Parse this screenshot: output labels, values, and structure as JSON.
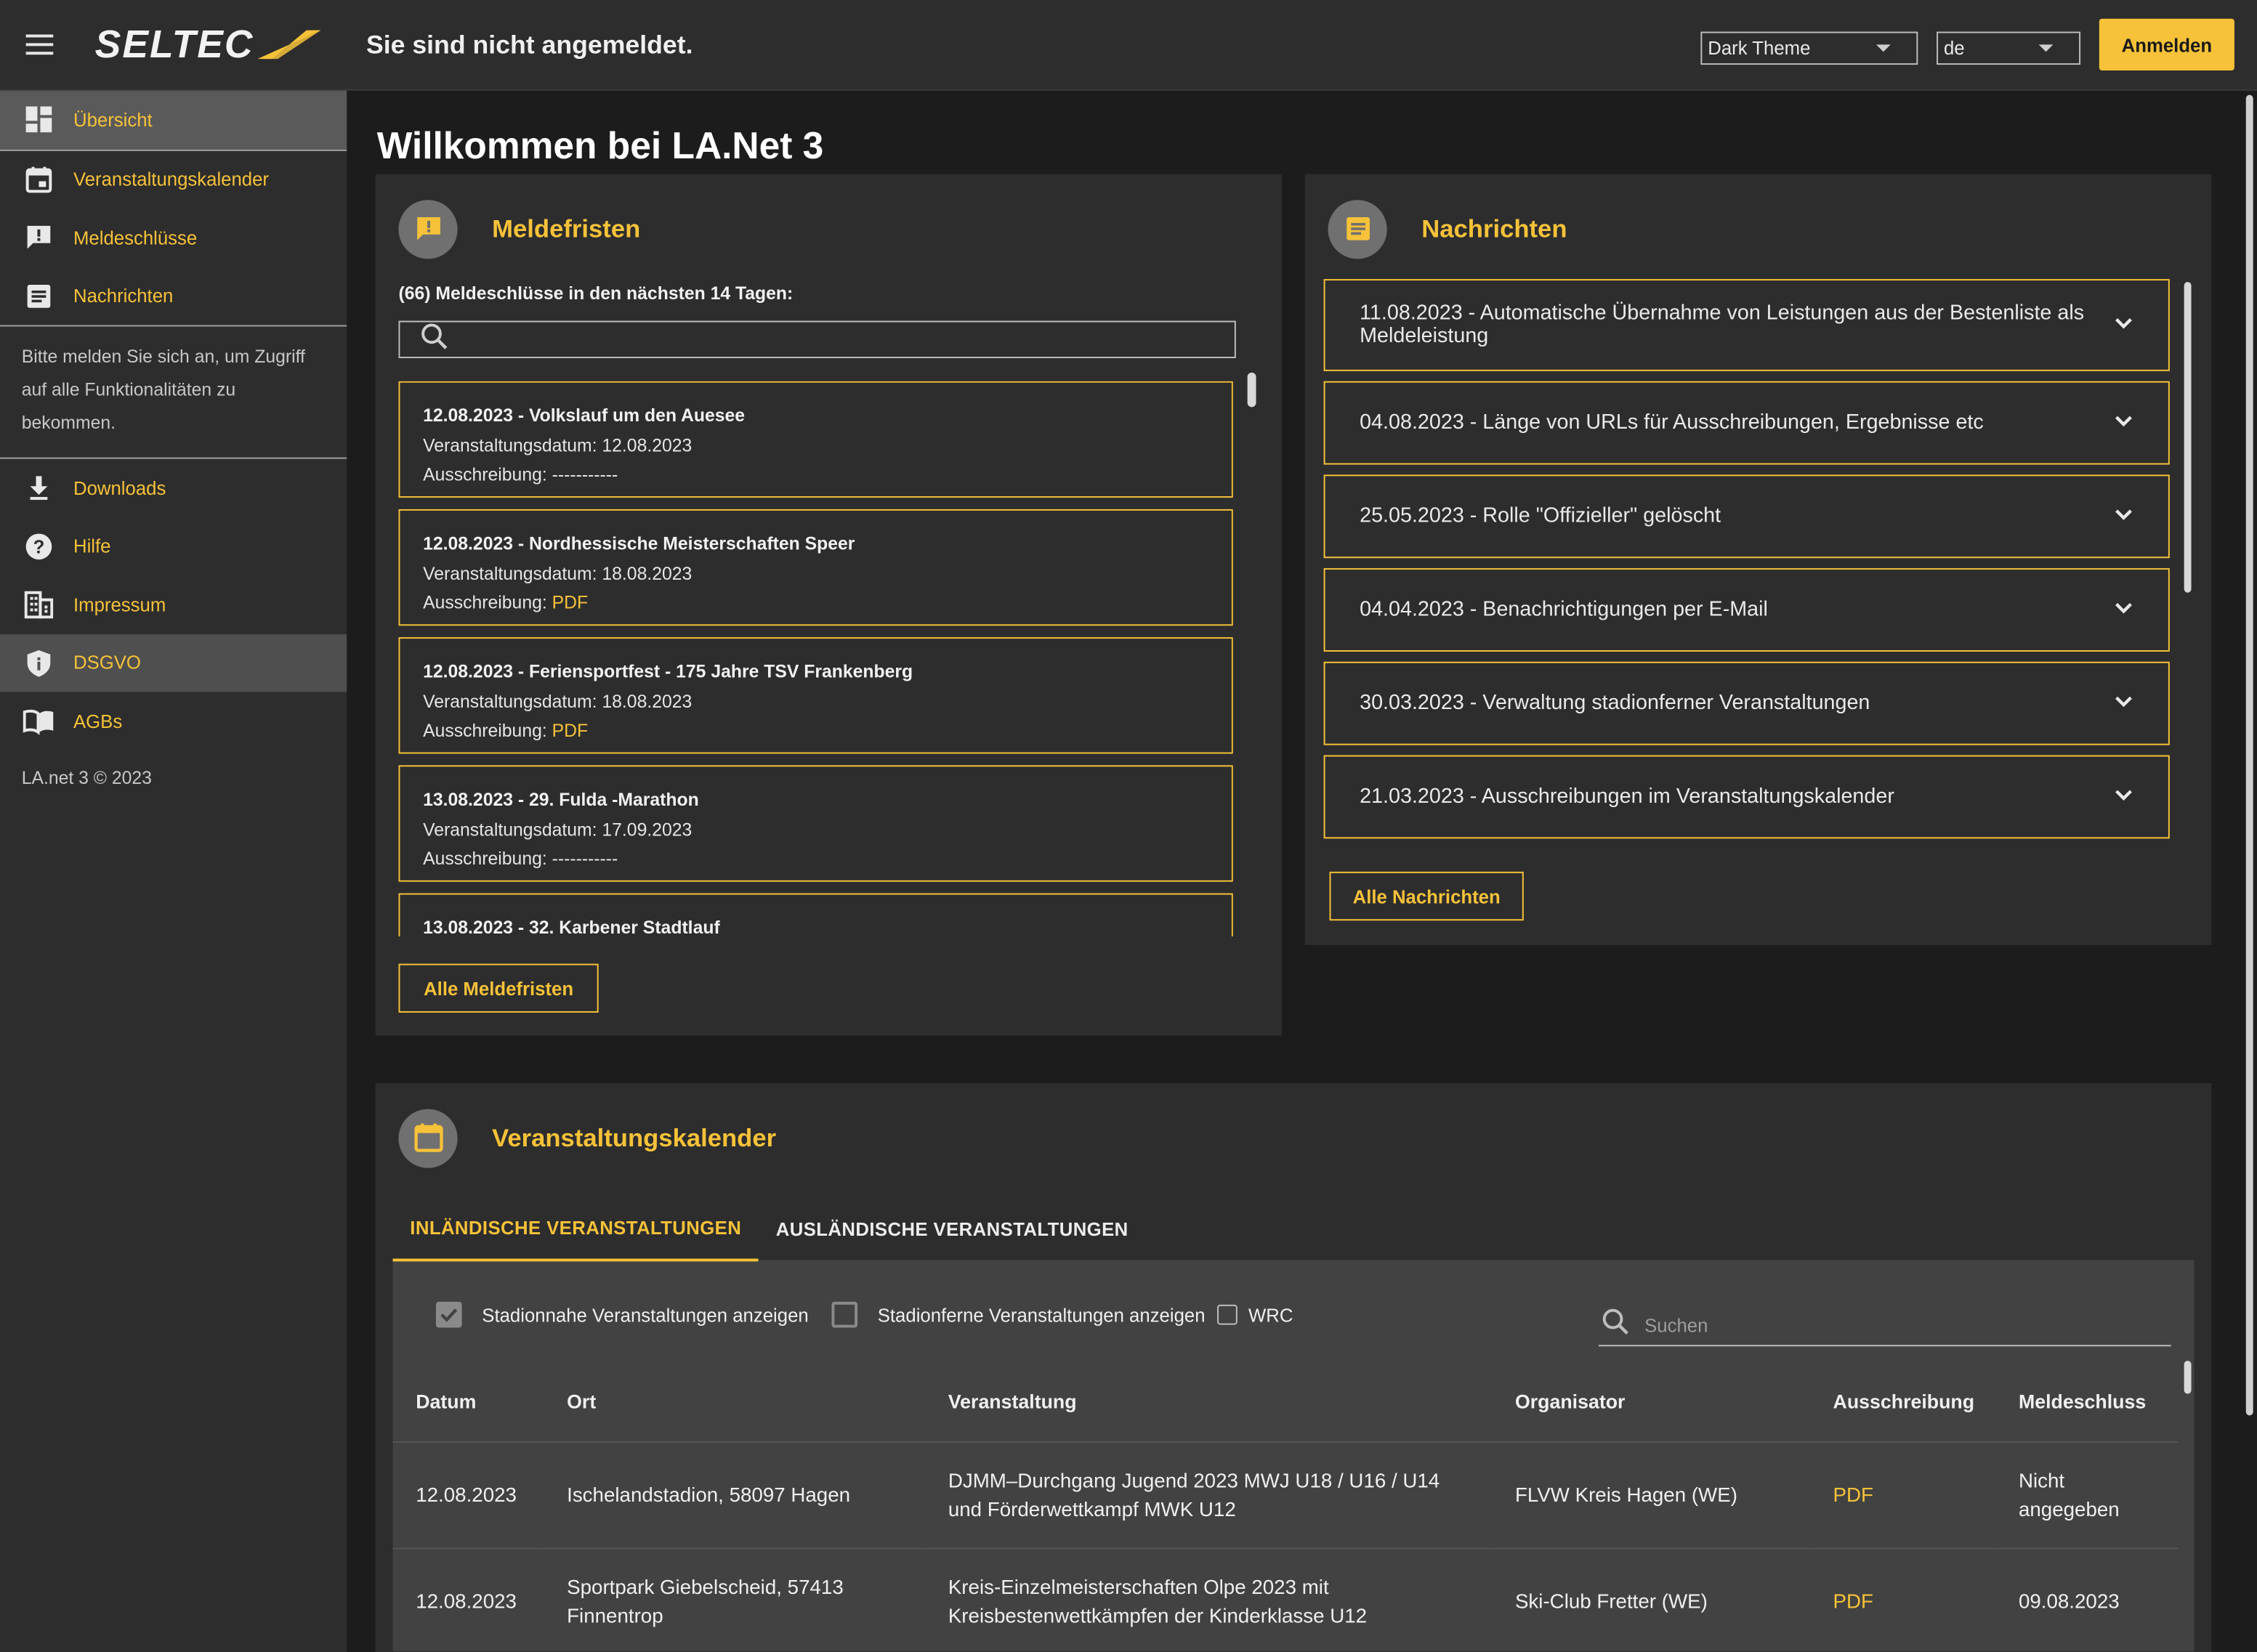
{
  "header": {
    "logo": "SELTEC",
    "status": "Sie sind nicht angemeldet.",
    "theme_select": "Dark Theme",
    "language_select": "de",
    "login_label": "Anmelden"
  },
  "sidebar": {
    "items_top": [
      {
        "label": "Übersicht",
        "icon": "dashboard-icon"
      },
      {
        "label": "Veranstaltungskalender",
        "icon": "calendar-icon"
      },
      {
        "label": "Meldeschlüsse",
        "icon": "alert-chat-icon"
      },
      {
        "label": "Nachrichten",
        "icon": "article-icon"
      }
    ],
    "note": "Bitte melden Sie sich an, um Zugriff auf alle Funktionalitäten zu bekommen.",
    "items_bottom": [
      {
        "label": "Downloads",
        "icon": "download-icon"
      },
      {
        "label": "Hilfe",
        "icon": "help-icon"
      },
      {
        "label": "Impressum",
        "icon": "building-icon"
      },
      {
        "label": "DSGVO",
        "icon": "shield-icon"
      },
      {
        "label": "AGBs",
        "icon": "book-icon"
      }
    ],
    "copyright": "LA.net 3 © 2023"
  },
  "page_title": "Willkommen bei LA.Net 3",
  "deadlines": {
    "title": "Meldefristen",
    "count_text": "(66) Meldeschlüsse in den nächsten 14 Tagen:",
    "items": [
      {
        "title": "12.08.2023 - Volkslauf um den Auesee",
        "date_line": "Veranstaltungsdatum: 12.08.2023",
        "tender_label": "Ausschreibung: ",
        "tender_value": "-----------",
        "tender_is_link": false
      },
      {
        "title": "12.08.2023 - Nordhessische Meisterschaften Speer",
        "date_line": "Veranstaltungsdatum: 18.08.2023",
        "tender_label": "Ausschreibung: ",
        "tender_value": "PDF",
        "tender_is_link": true
      },
      {
        "title": "12.08.2023 - Feriensportfest - 175 Jahre TSV Frankenberg",
        "date_line": "Veranstaltungsdatum: 18.08.2023",
        "tender_label": "Ausschreibung: ",
        "tender_value": "PDF",
        "tender_is_link": true
      },
      {
        "title": "13.08.2023 - 29. Fulda -Marathon",
        "date_line": "Veranstaltungsdatum: 17.09.2023",
        "tender_label": "Ausschreibung: ",
        "tender_value": "-----------",
        "tender_is_link": false
      },
      {
        "title": "13.08.2023 - 32. Karbener Stadtlauf",
        "date_line": "",
        "tender_label": "",
        "tender_value": "",
        "tender_is_link": false
      }
    ],
    "all_button": "Alle Meldefristen"
  },
  "news": {
    "title": "Nachrichten",
    "items": [
      "11.08.2023 - Automatische Übernahme von Leistungen aus der Bestenliste als Meldeleistung",
      "04.08.2023 - Länge von URLs für Ausschreibungen, Ergebnisse etc",
      "25.05.2023 - Rolle \"Offizieller\" gelöscht",
      "04.04.2023 - Benachrichtigungen per E-Mail",
      "30.03.2023 - Verwaltung stadionferner Veranstaltungen",
      "21.03.2023 - Ausschreibungen im Veranstaltungskalender"
    ],
    "all_button": "Alle Nachrichten"
  },
  "calendar": {
    "title": "Veranstaltungskalender",
    "tabs": [
      "INLÄNDISCHE VERANSTALTUNGEN",
      "AUSLÄNDISCHE VERANSTALTUNGEN"
    ],
    "filters": {
      "stadium_near": "Stadionnahe Veranstaltungen anzeigen",
      "stadium_far": "Stadionferne Veranstaltungen anzeigen",
      "wrc": "WRC",
      "search_placeholder": "Suchen"
    },
    "columns": [
      "Datum",
      "Ort",
      "Veranstaltung",
      "Organisator",
      "Ausschreibung",
      "Meldeschluss"
    ],
    "rows": [
      [
        "12.08.2023",
        "Ischelandstadion, 58097 Hagen",
        "DJMM–Durchgang Jugend 2023 MWJ U18 / U16 / U14 und Förderwettkampf MWK U12",
        "FLVW Kreis Hagen (WE)",
        "PDF",
        "Nicht angegeben"
      ],
      [
        "12.08.2023",
        "Sportpark Giebelscheid, 57413 Finnentrop",
        "Kreis-Einzelmeisterschaften Olpe 2023 mit Kreisbestenwettkämpfen der Kinderklasse U12",
        "Ski-Club Fretter (WE)",
        "PDF",
        "09.08.2023"
      ]
    ]
  },
  "colors": {
    "accent": "#f6c239",
    "background": "#1c1c1c",
    "surface": "#2d2d2d"
  }
}
